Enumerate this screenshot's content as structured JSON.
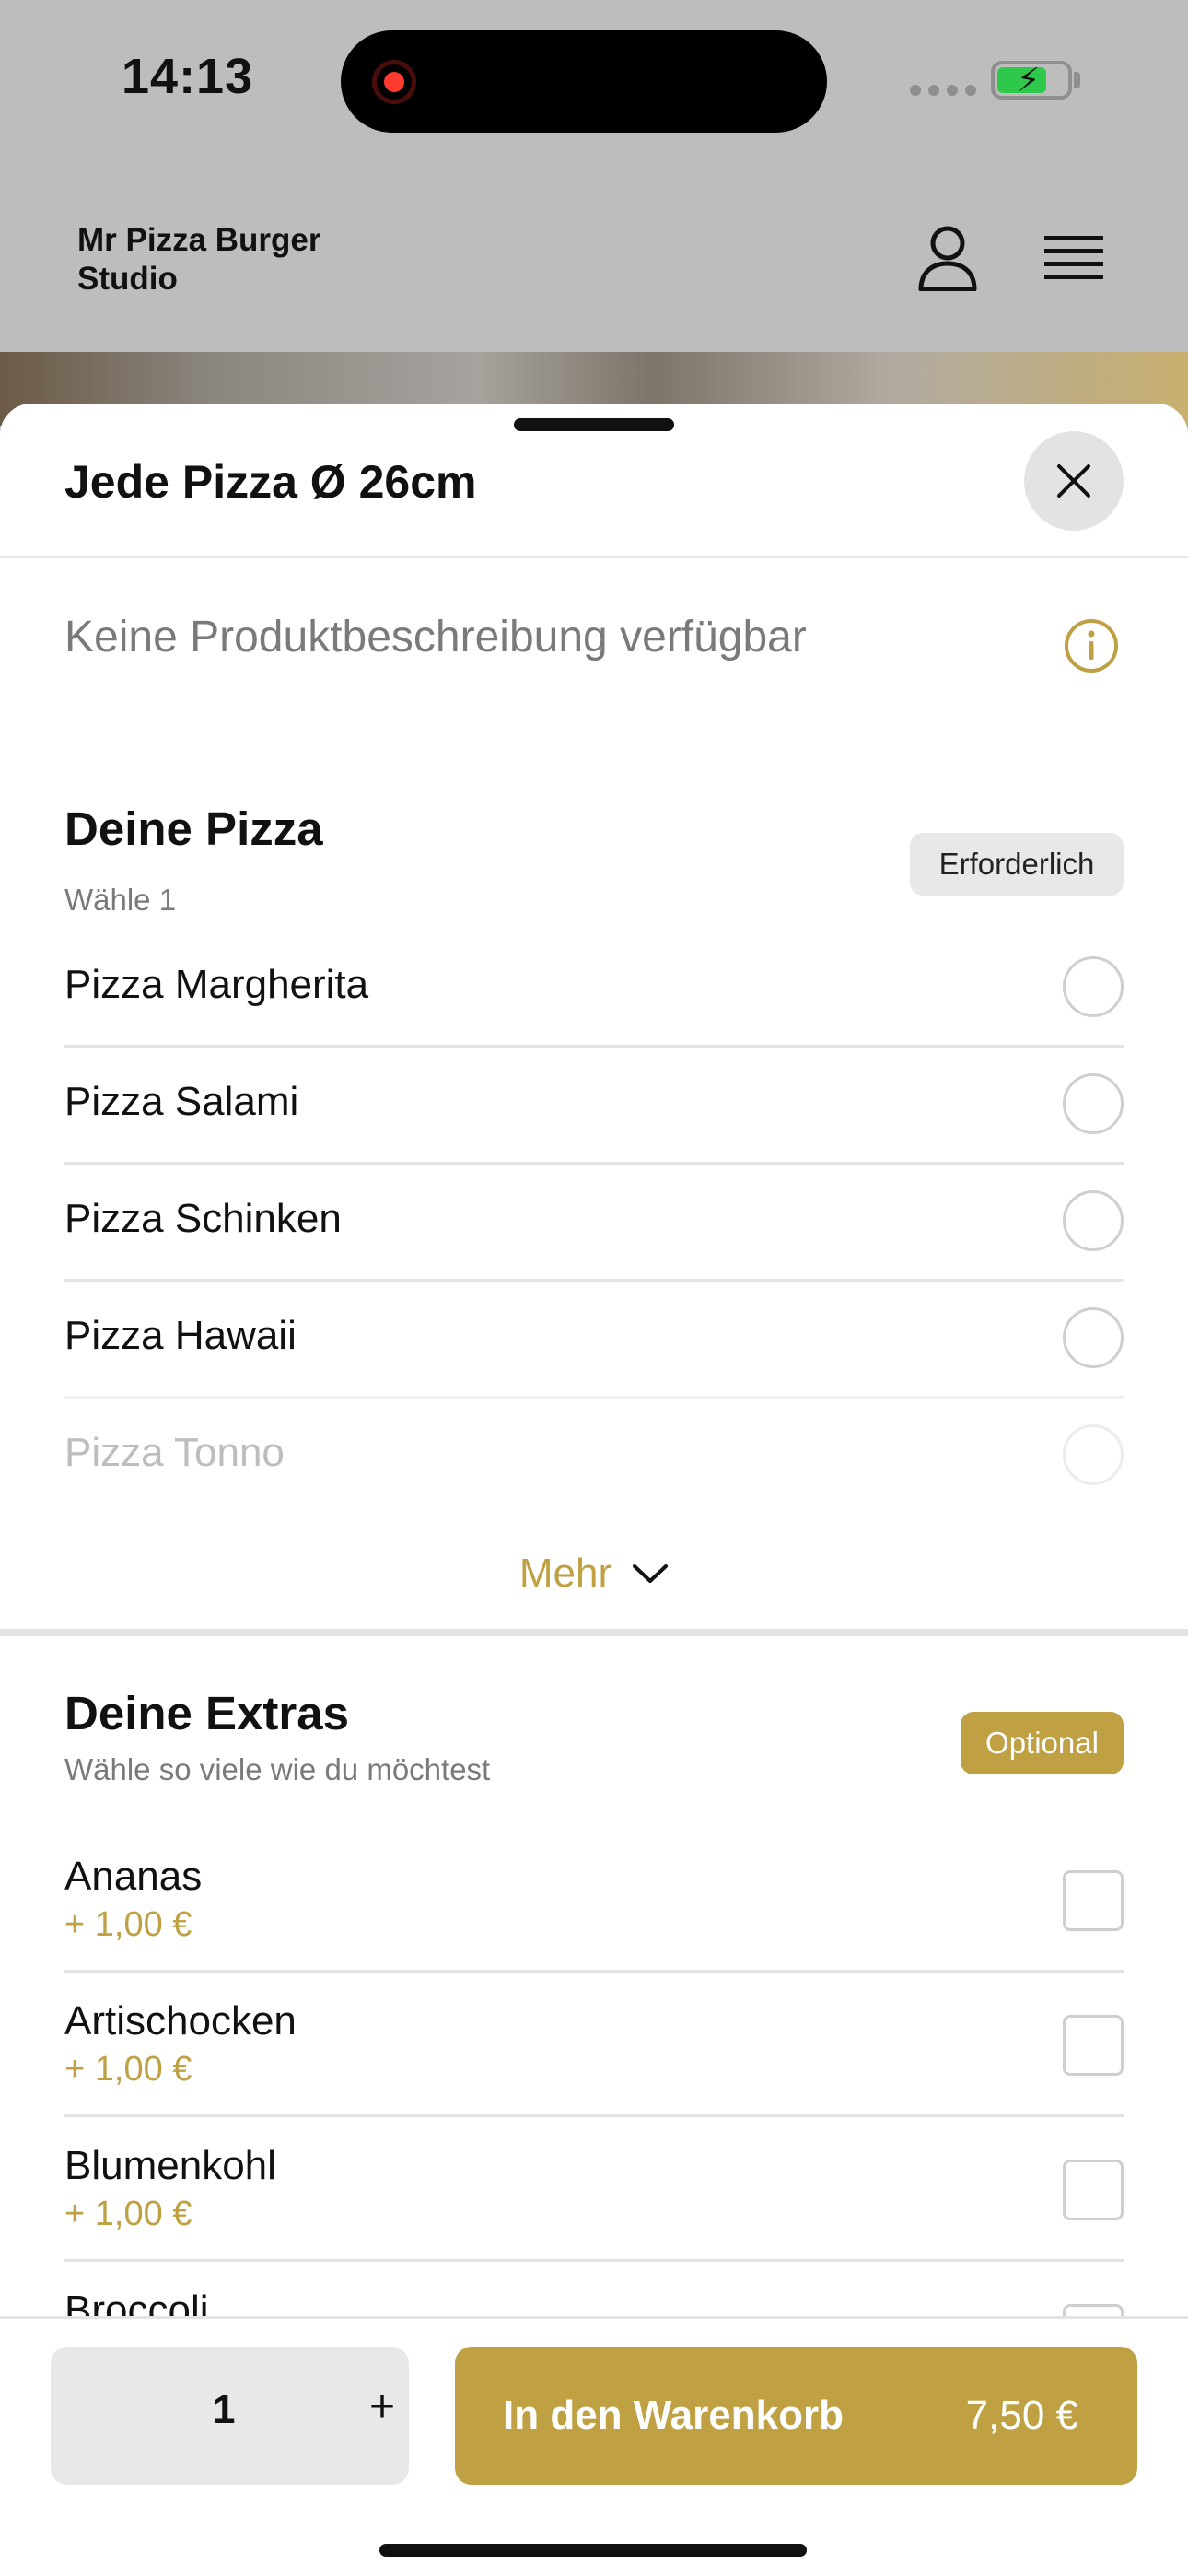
{
  "status_bar": {
    "time": "14:13",
    "icons": [
      "record-icon",
      "signal-icon",
      "battery-charging-icon"
    ]
  },
  "header": {
    "brand": "Mr Pizza Burger Studio",
    "icons": [
      "user-icon",
      "menu-icon"
    ]
  },
  "sheet": {
    "title": "Jede Pizza Ø 26cm",
    "description": "Keine Produktbeschreibung verfügbar"
  },
  "pizza_section": {
    "title": "Deine Pizza",
    "subtitle": "Wähle 1",
    "badge": "Erforderlich",
    "options": [
      {
        "label": "Pizza Margherita"
      },
      {
        "label": "Pizza Salami"
      },
      {
        "label": "Pizza Schinken"
      },
      {
        "label": "Pizza Hawaii"
      },
      {
        "label": "Pizza Tonno"
      }
    ],
    "more_label": "Mehr"
  },
  "extras_section": {
    "title": "Deine Extras",
    "subtitle": "Wähle so viele wie du möchtest",
    "badge": "Optional",
    "items": [
      {
        "label": "Ananas",
        "price": "+ 1,00 €"
      },
      {
        "label": "Artischocken",
        "price": "+ 1,00 €"
      },
      {
        "label": "Blumenkohl",
        "price": "+ 1,00 €"
      },
      {
        "label": "Broccoli",
        "price": ""
      }
    ]
  },
  "footer": {
    "quantity": "1",
    "plus": "+",
    "cart_label": "In den Warenkorb",
    "cart_price": "7,50 €"
  },
  "colors": {
    "accent": "#bfa144",
    "overlay": "#bdbdbd",
    "divider": "#e3e3e3"
  }
}
